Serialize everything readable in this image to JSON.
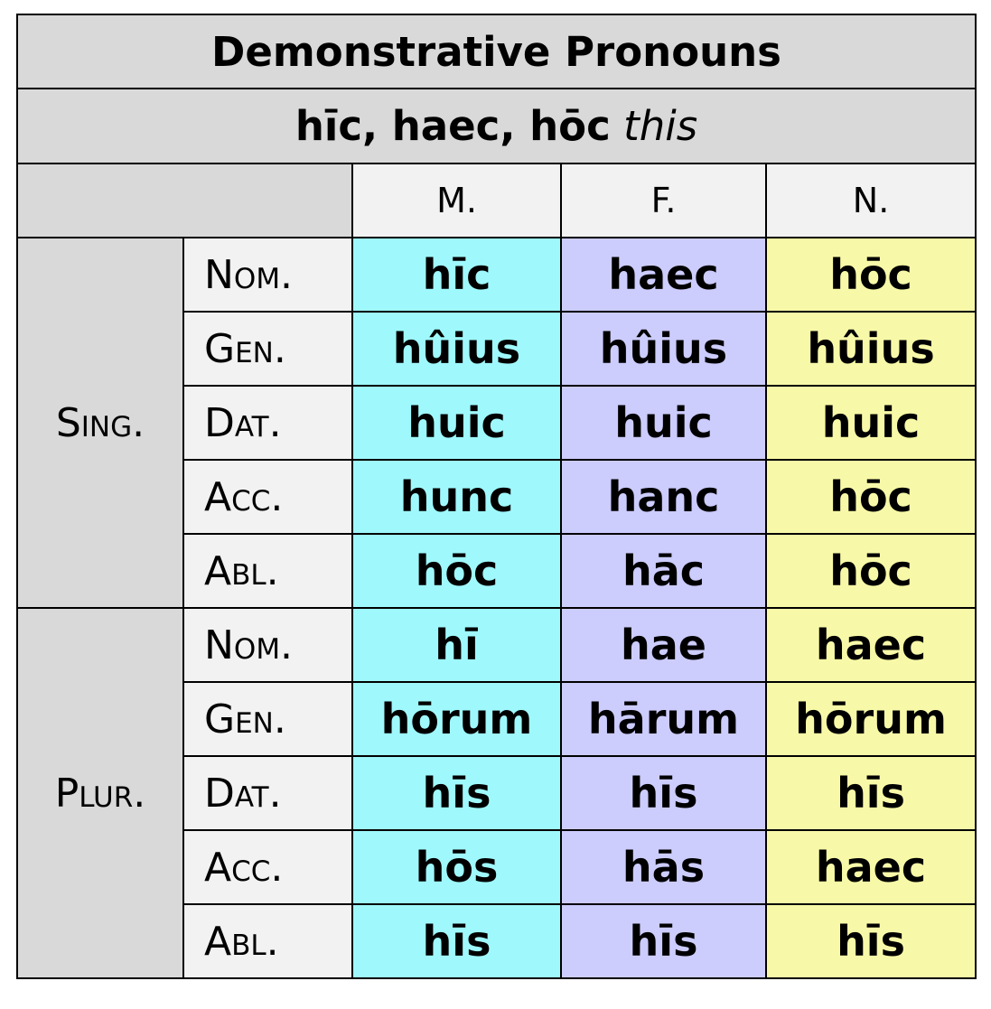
{
  "title": "Demonstrative Pronouns",
  "subtitle": {
    "forms": "hīc, haec, hōc",
    "gloss": "this"
  },
  "genders": [
    "M.",
    "F.",
    "N."
  ],
  "colors": {
    "masculine": "#9ff8fc",
    "feminine": "#ccccfd",
    "neuter": "#f8f9a8",
    "header": "#d9d9d9",
    "label": "#f2f2f2"
  },
  "groups": [
    {
      "number": "Sing.",
      "rows": [
        {
          "case": "Nom.",
          "m": "hīc",
          "f": "haec",
          "n": "hōc"
        },
        {
          "case": "Gen.",
          "m": "hûius",
          "f": "hûius",
          "n": "hûius"
        },
        {
          "case": "Dat.",
          "m": "huic",
          "f": "huic",
          "n": "huic"
        },
        {
          "case": "Acc.",
          "m": "hunc",
          "f": "hanc",
          "n": "hōc"
        },
        {
          "case": "Abl.",
          "m": "hōc",
          "f": "hāc",
          "n": "hōc"
        }
      ]
    },
    {
      "number": "Plur.",
      "rows": [
        {
          "case": "Nom.",
          "m": "hī",
          "f": "hae",
          "n": "haec"
        },
        {
          "case": "Gen.",
          "m": "hōrum",
          "f": "hārum",
          "n": "hōrum"
        },
        {
          "case": "Dat.",
          "m": "hīs",
          "f": "hīs",
          "n": "hīs"
        },
        {
          "case": "Acc.",
          "m": "hōs",
          "f": "hās",
          "n": "haec"
        },
        {
          "case": "Abl.",
          "m": "hīs",
          "f": "hīs",
          "n": "hīs"
        }
      ]
    }
  ]
}
